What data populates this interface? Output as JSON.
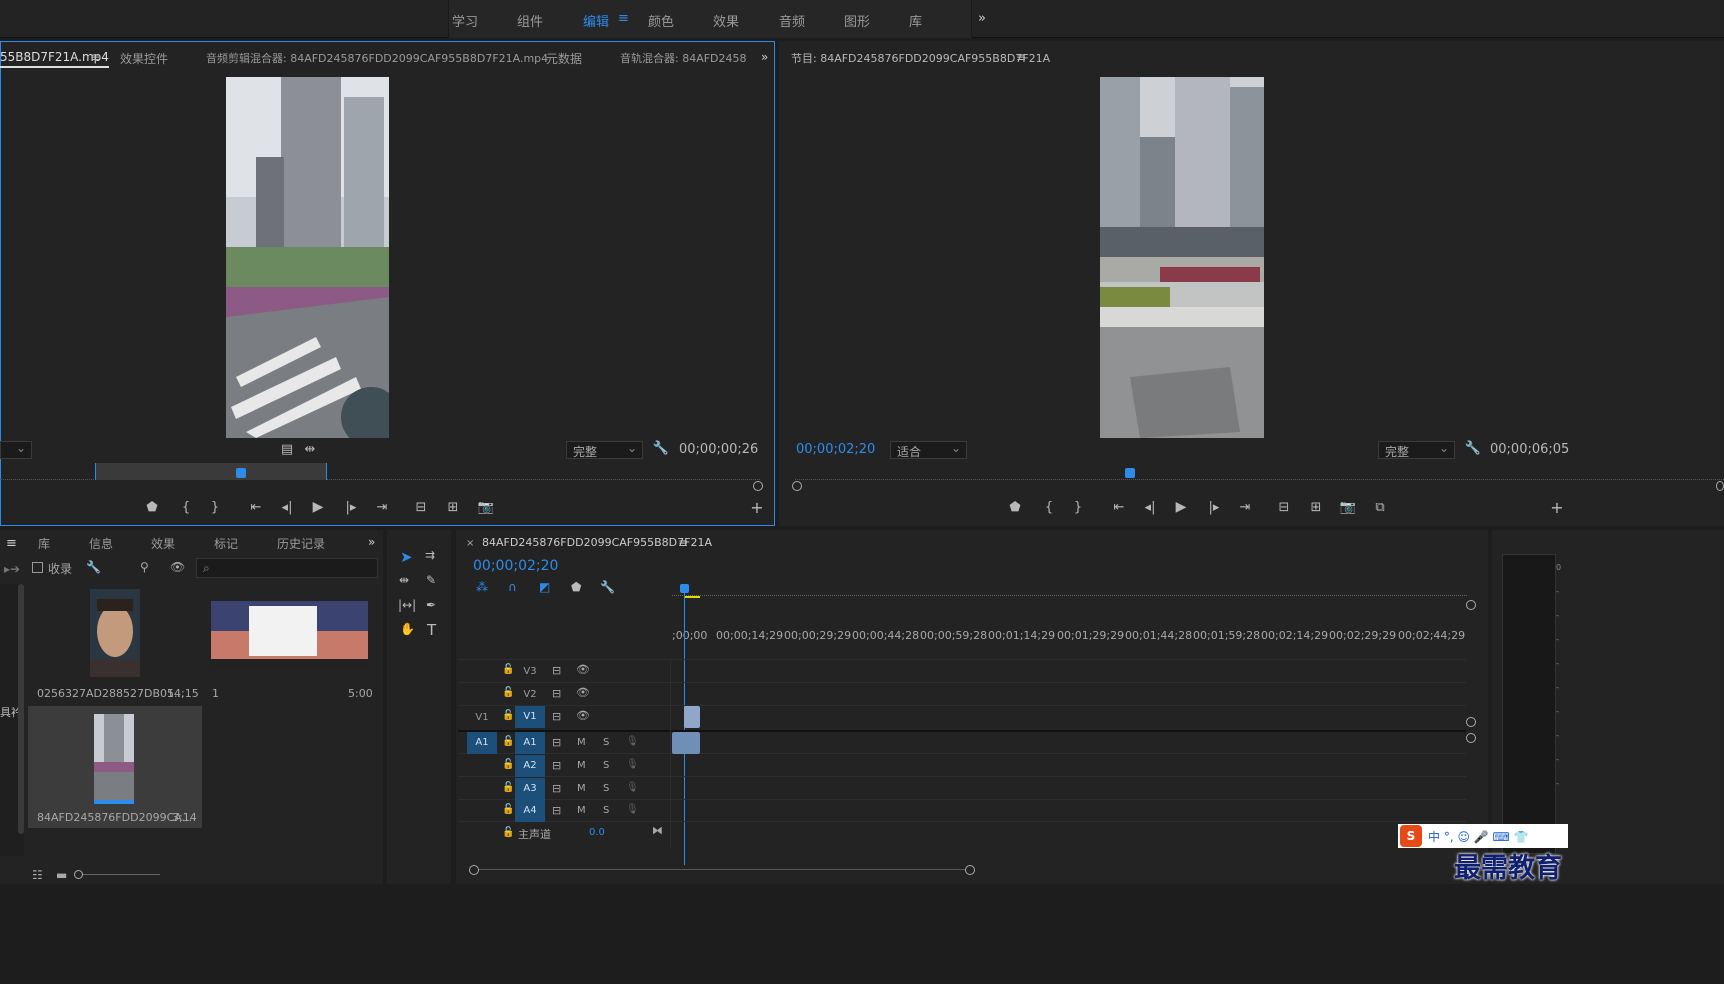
{
  "workspaces": {
    "learn": "学习",
    "assembly": "组件",
    "edit": "编辑",
    "color": "颜色",
    "effects": "效果",
    "audio": "音频",
    "graphics": "图形",
    "libraries": "库"
  },
  "source_monitor": {
    "tabs": [
      "55B8D7F21A.mp4",
      "效果控件",
      "音频剪辑混合器: 84AFD245876FDD2099CAF955B8D7F21A.mp4",
      "元数据",
      "音轨混合器: 84AFD2458"
    ],
    "resolution": "完整",
    "duration": "00;00;00;26"
  },
  "program_monitor": {
    "title": "节目: 84AFD245876FDD2099CAF955B8D7F21A",
    "timecode": "00;00;02;20",
    "zoom": "适合",
    "resolution": "完整",
    "duration": "00;00;06;05"
  },
  "project_panel": {
    "tabs": [
      "库",
      "信息",
      "效果",
      "标记",
      "历史记录"
    ],
    "collect_label": "收录",
    "side_text": "具衿",
    "items": [
      {
        "name": "0256327AD288527DB05...",
        "duration": "14;15"
      },
      {
        "name": "1",
        "duration": "5:00"
      },
      {
        "name": "84AFD245876FDD2099CA...",
        "duration": "3;14"
      }
    ]
  },
  "timeline": {
    "sequence_name": "84AFD245876FDD2099CAF955B8D7F21A",
    "timecode": "00;00;02;20",
    "ruler": [
      ";00;00",
      "00;00;14;29",
      "00;00;29;29",
      "00;00;44;28",
      "00;00;59;28",
      "00;01;14;29",
      "00;01;29;29",
      "00;01;44;28",
      "00;01;59;28",
      "00;02;14;29",
      "00;02;29;29",
      "00;02;44;29"
    ],
    "video_tracks": [
      "V3",
      "V2",
      "V1"
    ],
    "audio_tracks": [
      "A1",
      "A2",
      "A3",
      "A4"
    ],
    "v1_source": "V1",
    "a1_source": "A1",
    "mute": "M",
    "solo": "S",
    "master_label": "主声道",
    "master_value": "0.0"
  },
  "ime": {
    "text": "中 °, ☺ 🎤 ⌨ 👕"
  },
  "watermark": "最需教育",
  "accent": "#2d8ceb"
}
